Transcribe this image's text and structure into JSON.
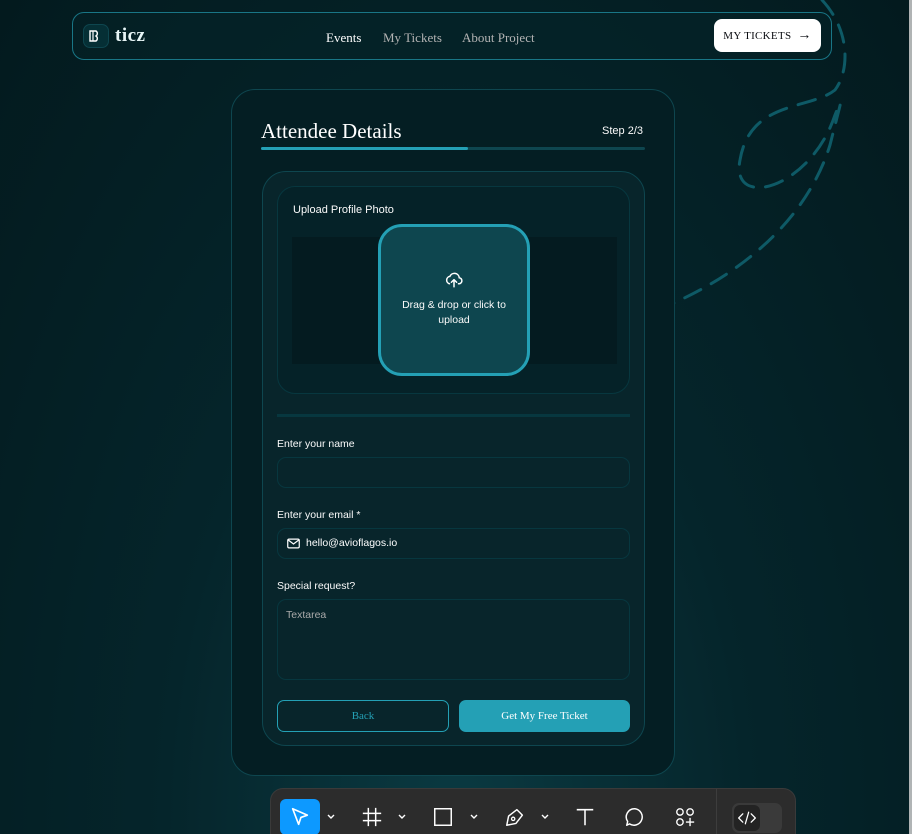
{
  "header": {
    "logo_text": "ticz",
    "nav": [
      "Events",
      "My Tickets",
      "About Project"
    ],
    "cta_label": "MY TICKETS",
    "cta_arrow": "→"
  },
  "card": {
    "title": "Attendee Details",
    "step": "Step 2/3",
    "progress": 0.54
  },
  "upload": {
    "label": "Upload Profile Photo",
    "dropzone_text": "Drag & drop or click to upload"
  },
  "form": {
    "name_label": "Enter your name",
    "name_value": "",
    "email_label": "Enter your email *",
    "email_value": "hello@avioflagos.io",
    "request_label": "Special request?",
    "request_placeholder": "Textarea"
  },
  "actions": {
    "back_label": "Back",
    "submit_label": "Get My Free Ticket"
  },
  "toolbar": {
    "tools": [
      "move-icon",
      "frame-icon",
      "rectangle-icon",
      "pen-icon",
      "text-icon",
      "comment-icon",
      "actions-icon",
      "dev-mode-icon"
    ]
  },
  "colors": {
    "accent": "#24a0b5",
    "border": "#0e464f",
    "background": "#041e23",
    "toolbar_active": "#0d99ff"
  }
}
